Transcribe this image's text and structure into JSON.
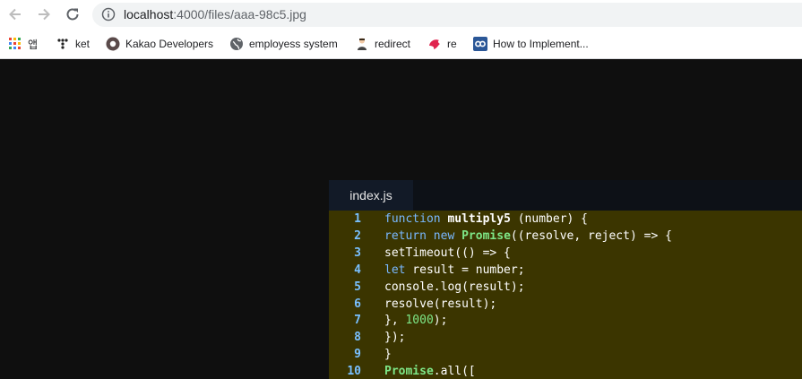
{
  "browser": {
    "url_host": "localhost",
    "url_path": ":4000/files/aaa-98c5.jpg"
  },
  "bookmarks": [
    {
      "label": "앱",
      "icon": "apps-grid-icon"
    },
    {
      "label": "ket",
      "icon": "ket-logo-icon"
    },
    {
      "label": "Kakao Developers",
      "icon": "kakao-icon"
    },
    {
      "label": "employess system",
      "icon": "globe-icon"
    },
    {
      "label": "redirect",
      "icon": "person-icon"
    },
    {
      "label": "re",
      "icon": "nest-icon"
    },
    {
      "label": "How to Implement...",
      "icon": "co-icon"
    }
  ],
  "colors": {
    "code_highlight": "#3b3500",
    "line_number": "#79c0ff",
    "keyword": "#79b8ff",
    "class": "#7ee787"
  },
  "editor": {
    "tab_label": "index.js",
    "lines": [
      {
        "n": "1",
        "parts": [
          {
            "t": "function",
            "c": "kw"
          },
          {
            "t": " "
          },
          {
            "t": "multiply5",
            "c": "fn"
          },
          {
            "t": " (number) {"
          }
        ]
      },
      {
        "n": "2",
        "parts": [
          {
            "t": "return",
            "c": "kw"
          },
          {
            "t": " "
          },
          {
            "t": "new",
            "c": "kw"
          },
          {
            "t": " "
          },
          {
            "t": "Promise",
            "c": "cls"
          },
          {
            "t": "((resolve, reject) => {"
          }
        ]
      },
      {
        "n": "3",
        "parts": [
          {
            "t": "setTimeout(() => {"
          }
        ]
      },
      {
        "n": "4",
        "parts": [
          {
            "t": "let",
            "c": "kw"
          },
          {
            "t": " result = number;"
          }
        ]
      },
      {
        "n": "5",
        "parts": [
          {
            "t": "console.log(result);"
          }
        ]
      },
      {
        "n": "6",
        "parts": [
          {
            "t": "resolve(result);"
          }
        ]
      },
      {
        "n": "7",
        "parts": [
          {
            "t": "}, "
          },
          {
            "t": "1000",
            "c": "num"
          },
          {
            "t": ");"
          }
        ]
      },
      {
        "n": "8",
        "parts": [
          {
            "t": "});"
          }
        ]
      },
      {
        "n": "9",
        "parts": [
          {
            "t": "}"
          }
        ]
      },
      {
        "n": "10",
        "parts": [
          {
            "t": "Promise",
            "c": "cls"
          },
          {
            "t": ".all(["
          }
        ]
      }
    ]
  }
}
